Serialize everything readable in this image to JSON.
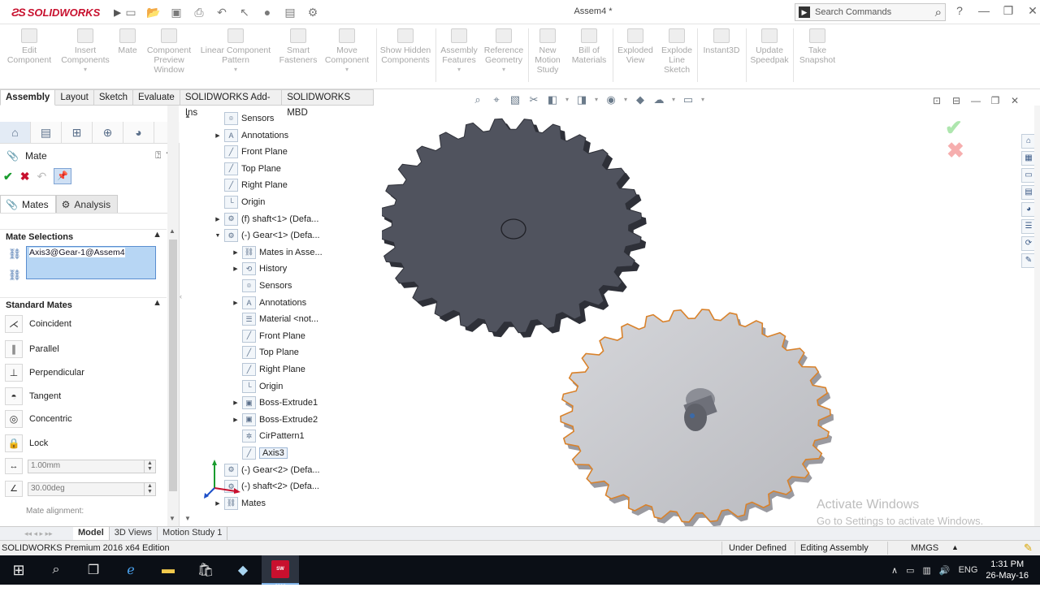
{
  "app": {
    "brand": "SOLIDWORKS",
    "document_title": "Assem4 *",
    "search_placeholder": "Search Commands"
  },
  "ribbon": {
    "buttons": [
      {
        "label": "Edit Component"
      },
      {
        "label": "Insert Components"
      },
      {
        "label": "Mate"
      },
      {
        "label": "Component Preview Window"
      },
      {
        "label": "Linear Component Pattern"
      },
      {
        "label": "Smart Fasteners"
      },
      {
        "label": "Move Component"
      },
      {
        "label": "Show Hidden Components"
      },
      {
        "label": "Assembly Features"
      },
      {
        "label": "Reference Geometry"
      },
      {
        "label": "New Motion Study"
      },
      {
        "label": "Bill of Materials"
      },
      {
        "label": "Exploded View"
      },
      {
        "label": "Explode Line Sketch"
      },
      {
        "label": "Instant3D"
      },
      {
        "label": "Update Speedpak"
      },
      {
        "label": "Take Snapshot"
      }
    ]
  },
  "command_tabs": [
    "Assembly",
    "Layout",
    "Sketch",
    "Evaluate",
    "SOLIDWORKS Add-Ins",
    "SOLIDWORKS MBD"
  ],
  "property_manager": {
    "title": "Mate",
    "subtabs": [
      "Mates",
      "Analysis"
    ],
    "mate_selections": {
      "heading": "Mate Selections",
      "selected": "Axis3@Gear-1@Assem4"
    },
    "standard_mates": {
      "heading": "Standard Mates",
      "items": [
        "Coincident",
        "Parallel",
        "Perpendicular",
        "Tangent",
        "Concentric",
        "Lock"
      ]
    },
    "distance_value": "1.00mm",
    "angle_value": "30.00deg",
    "mate_alignment_label": "Mate alignment:"
  },
  "feature_tree": {
    "items": [
      {
        "label": "Sensors",
        "level": 1,
        "expander": false
      },
      {
        "label": "Annotations",
        "level": 1,
        "expander": true
      },
      {
        "label": "Front Plane",
        "level": 1,
        "expander": false
      },
      {
        "label": "Top Plane",
        "level": 1,
        "expander": false
      },
      {
        "label": "Right Plane",
        "level": 1,
        "expander": false
      },
      {
        "label": "Origin",
        "level": 1,
        "expander": false
      },
      {
        "label": "(f) shaft<1> (Defa...",
        "level": 1,
        "expander": true
      },
      {
        "label": "(-) Gear<1> (Defa...",
        "level": 1,
        "expander": true,
        "expanded": true
      },
      {
        "label": "Mates in Asse...",
        "level": 2,
        "expander": true
      },
      {
        "label": "History",
        "level": 2,
        "expander": true
      },
      {
        "label": "Sensors",
        "level": 2,
        "expander": false
      },
      {
        "label": "Annotations",
        "level": 2,
        "expander": true
      },
      {
        "label": "Material <not...",
        "level": 2,
        "expander": false
      },
      {
        "label": "Front Plane",
        "level": 2,
        "expander": false
      },
      {
        "label": "Top Plane",
        "level": 2,
        "expander": false
      },
      {
        "label": "Right Plane",
        "level": 2,
        "expander": false
      },
      {
        "label": "Origin",
        "level": 2,
        "expander": false
      },
      {
        "label": "Boss-Extrude1",
        "level": 2,
        "expander": true
      },
      {
        "label": "Boss-Extrude2",
        "level": 2,
        "expander": true
      },
      {
        "label": "CirPattern1",
        "level": 2,
        "expander": false
      },
      {
        "label": "Axis3",
        "level": 2,
        "expander": false,
        "selected": true
      },
      {
        "label": "(-) Gear<2> (Defa...",
        "level": 1,
        "expander": false
      },
      {
        "label": "(-) shaft<2> (Defa...",
        "level": 1,
        "expander": false
      },
      {
        "label": "Mates",
        "level": 1,
        "expander": true
      }
    ]
  },
  "viewport": {
    "watermark_title": "Activate Windows",
    "watermark_sub": "Go to Settings to activate Windows."
  },
  "bottom_tabs": [
    "Model",
    "3D Views",
    "Motion Study 1"
  ],
  "status_bar": {
    "edition": "SOLIDWORKS Premium 2016 x64 Edition",
    "state": "Under Defined",
    "mode": "Editing Assembly",
    "units": "MMGS"
  },
  "taskbar": {
    "language": "ENG",
    "time": "1:31 PM",
    "date": "26-May-16",
    "sw_badge": "SW 2016"
  },
  "colors": {
    "gear_dark": "#50535e",
    "gear_light": "#c9cacf",
    "gear_highlight": "#d9822b",
    "brand_red": "#c8102e"
  }
}
